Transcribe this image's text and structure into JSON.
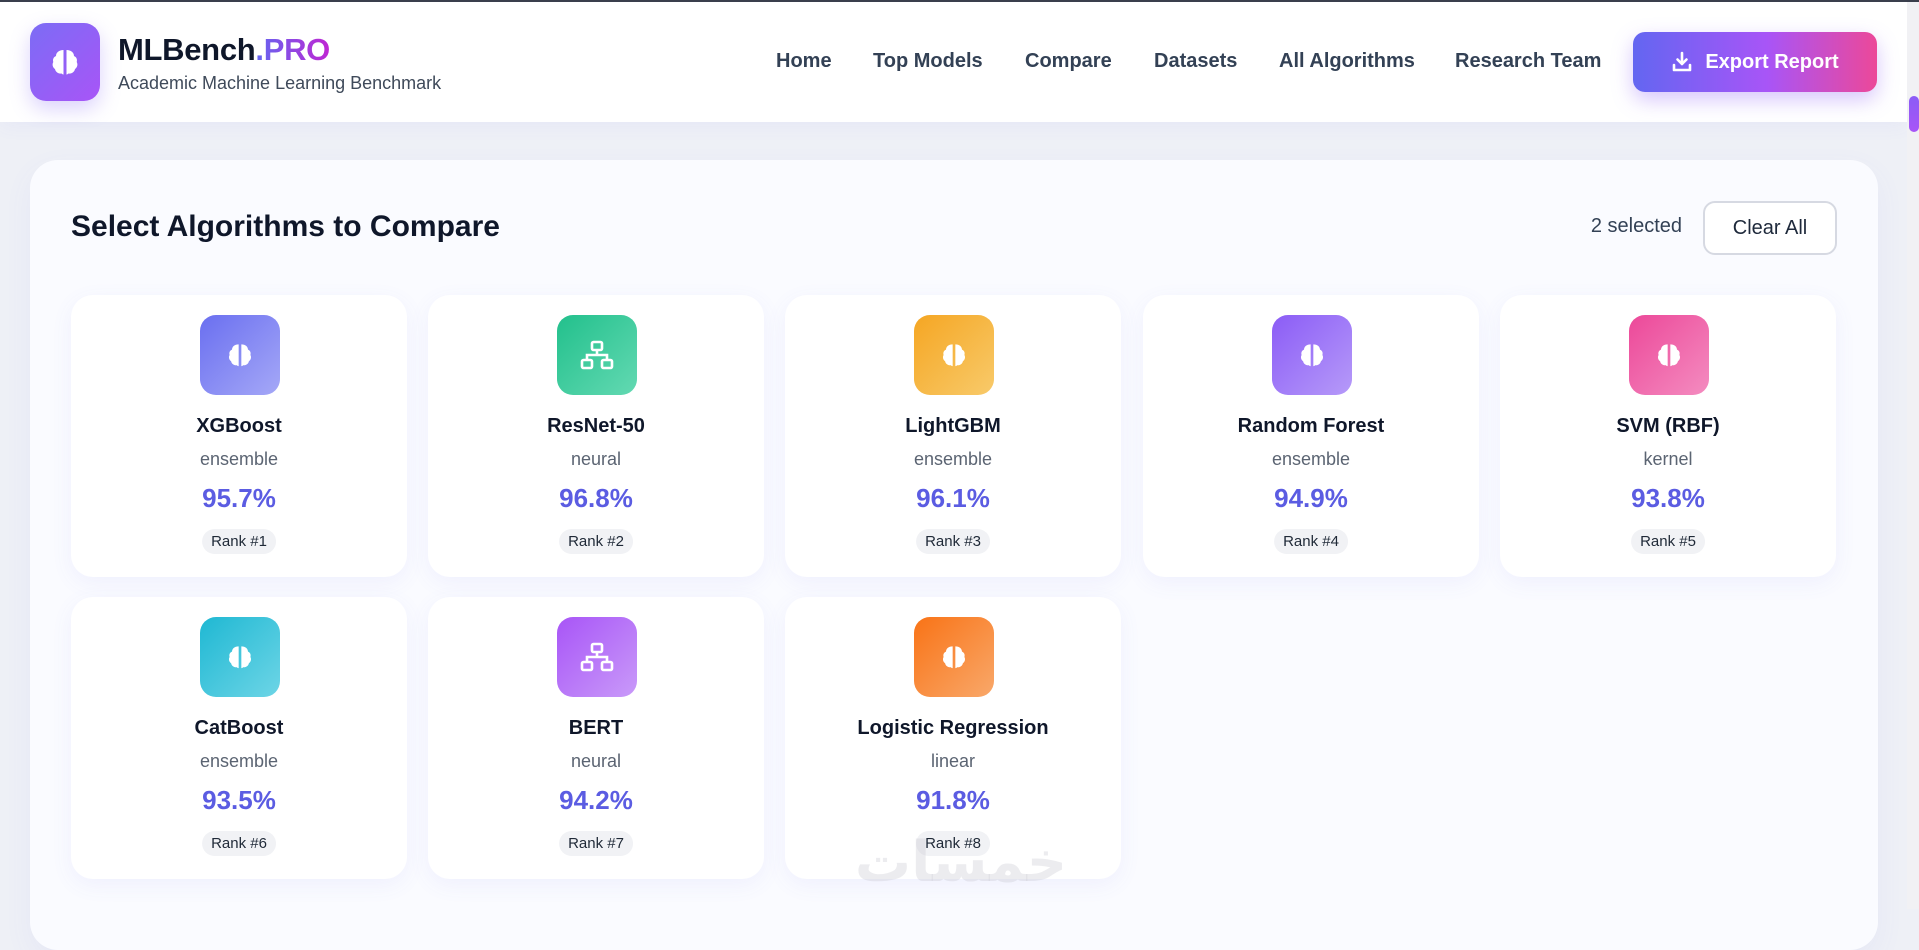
{
  "brand": {
    "name": "MLBench",
    "name_suffix": ".PRO",
    "subtitle": "Academic Machine Learning Benchmark",
    "logo_icon": "brain-icon"
  },
  "nav": {
    "items": [
      {
        "label": "Home"
      },
      {
        "label": "Top Models"
      },
      {
        "label": "Compare"
      },
      {
        "label": "Datasets"
      },
      {
        "label": "All Algorithms"
      },
      {
        "label": "Research Team"
      }
    ],
    "export_label": "Export Report",
    "export_icon": "download-icon"
  },
  "compare": {
    "title": "Select Algorithms to Compare",
    "selected_text": "2 selected",
    "clear_label": "Clear All"
  },
  "algorithms": [
    {
      "name": "XGBoost",
      "type": "ensemble",
      "score": "95.7%",
      "rank": "Rank #1",
      "icon": "brain-icon",
      "colors": [
        "#6a6ff0",
        "#a5a8f7"
      ]
    },
    {
      "name": "ResNet-50",
      "type": "neural",
      "score": "96.8%",
      "rank": "Rank #2",
      "icon": "network-icon",
      "colors": [
        "#22c08c",
        "#63d9b2"
      ]
    },
    {
      "name": "LightGBM",
      "type": "ensemble",
      "score": "96.1%",
      "rank": "Rank #3",
      "icon": "brain-icon",
      "colors": [
        "#f5a623",
        "#f8ca6a"
      ]
    },
    {
      "name": "Random Forest",
      "type": "ensemble",
      "score": "94.9%",
      "rank": "Rank #4",
      "icon": "brain-icon",
      "colors": [
        "#8b5cf6",
        "#b69af9"
      ]
    },
    {
      "name": "SVM (RBF)",
      "type": "kernel",
      "score": "93.8%",
      "rank": "Rank #5",
      "icon": "brain-icon",
      "colors": [
        "#ec4899",
        "#f48cc0"
      ]
    },
    {
      "name": "CatBoost",
      "type": "ensemble",
      "score": "93.5%",
      "rank": "Rank #6",
      "icon": "brain-icon",
      "colors": [
        "#1fb8d3",
        "#6dd5e6"
      ]
    },
    {
      "name": "BERT",
      "type": "neural",
      "score": "94.2%",
      "rank": "Rank #7",
      "icon": "network-icon",
      "colors": [
        "#a855f7",
        "#c99af9"
      ]
    },
    {
      "name": "Logistic Regression",
      "type": "linear",
      "score": "91.8%",
      "rank": "Rank #8",
      "icon": "brain-icon",
      "colors": [
        "#f97316",
        "#f9a86a"
      ]
    }
  ]
}
